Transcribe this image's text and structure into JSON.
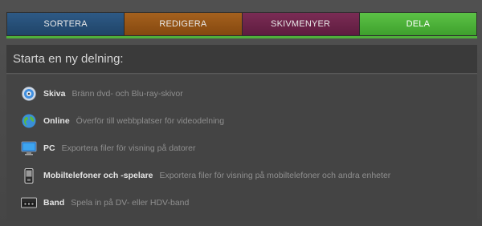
{
  "tabs": [
    {
      "label": "SORTERA"
    },
    {
      "label": "REDIGERA"
    },
    {
      "label": "SKIVMENYER"
    },
    {
      "label": "DELA"
    }
  ],
  "active_tab": "DELA",
  "heading": "Starta en ny delning:",
  "options": [
    {
      "label": "Skiva",
      "description": "Bränn dvd- och Blu-ray-skivor",
      "icon": "disc-icon"
    },
    {
      "label": "Online",
      "description": "Överför till webbplatser för videodelning",
      "icon": "globe-icon"
    },
    {
      "label": "PC",
      "description": "Exportera filer för visning på datorer",
      "icon": "monitor-icon"
    },
    {
      "label": "Mobiltelefoner och -spelare",
      "description": "Exportera filer för visning på mobiltelefoner och andra enheter",
      "icon": "mobile-phone-icon"
    },
    {
      "label": "Band",
      "description": "Spela in på DV- eller HDV-band",
      "icon": "tape-icon"
    }
  ],
  "colors": {
    "tab_sortera": "#2e5a86",
    "tab_redigera": "#a5611e",
    "tab_skivmenyer": "#7b2c55",
    "tab_dela": "#5cc246"
  }
}
